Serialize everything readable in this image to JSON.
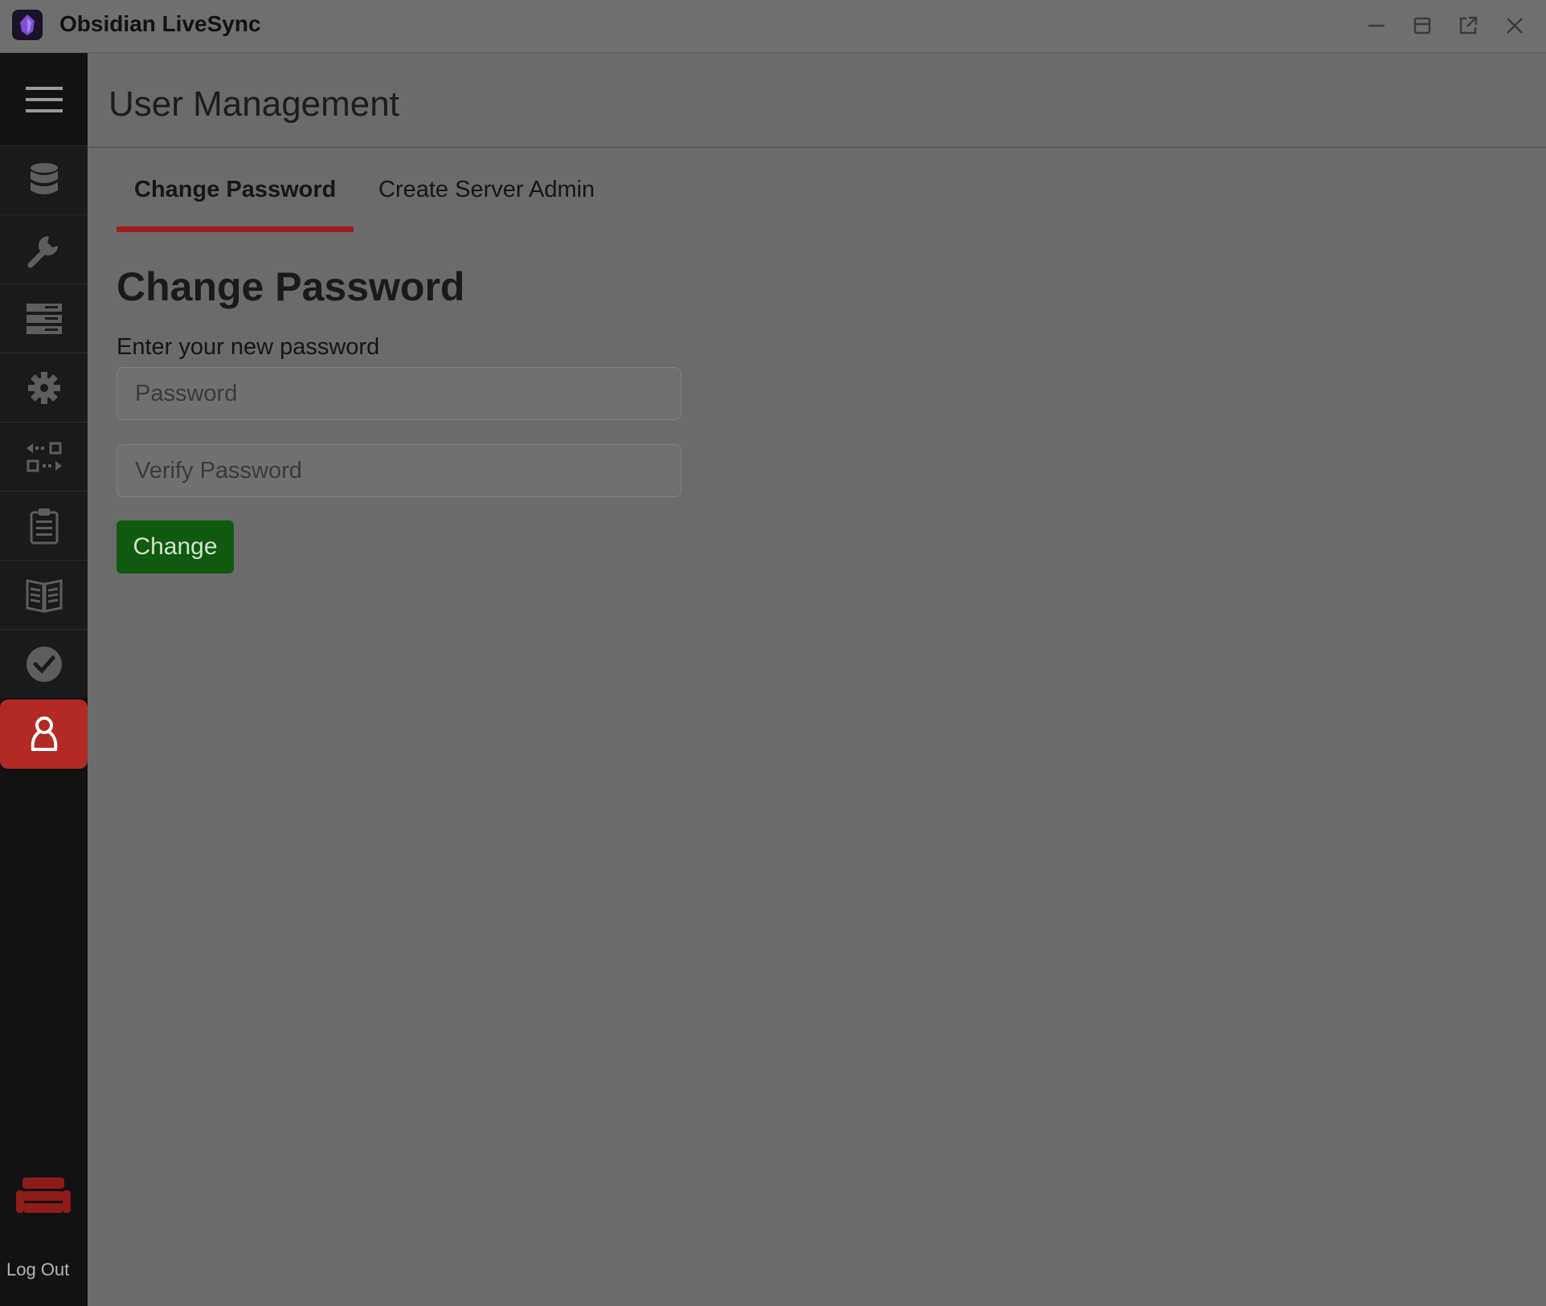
{
  "window": {
    "title": "Obsidian LiveSync",
    "controls": [
      "minimize-icon",
      "maximize-icon",
      "popout-icon",
      "close-icon"
    ]
  },
  "sidebar": {
    "menu_icon": "hamburger-icon",
    "items": [
      {
        "icon": "database-icon"
      },
      {
        "icon": "wrench-icon"
      },
      {
        "icon": "server-rack-icon"
      },
      {
        "icon": "gear-icon"
      },
      {
        "icon": "replication-icon"
      },
      {
        "icon": "clipboard-icon"
      },
      {
        "icon": "book-icon"
      },
      {
        "icon": "check-circle-icon"
      },
      {
        "icon": "user-icon",
        "active": true
      }
    ],
    "logo_icon": "couch-icon",
    "logout_label": "Log Out"
  },
  "main": {
    "title": "User Management",
    "tabs": [
      {
        "label": "Change Password",
        "active": true
      },
      {
        "label": "Create Server Admin",
        "active": false
      }
    ],
    "section_title": "Change Password",
    "field_label": "Enter your new password",
    "password_placeholder": "Password",
    "verify_placeholder": "Verify Password",
    "submit_label": "Change"
  },
  "colors": {
    "accent": "#b32a24",
    "tab_indicator": "#a31d1d",
    "submit": "#0f5a0f",
    "sidebar_bg": "#121212"
  }
}
